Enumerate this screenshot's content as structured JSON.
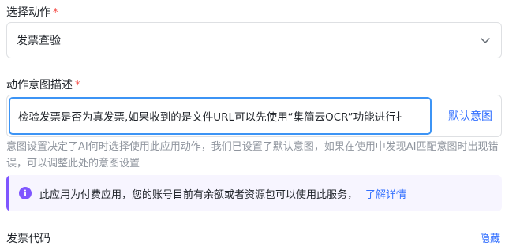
{
  "action_select": {
    "label": "选择动作",
    "required_mark": "*",
    "value": "发票查验",
    "chevron_icon": "chevron-down-icon"
  },
  "intent": {
    "label": "动作意图描述",
    "required_mark": "*",
    "value": "检验发票是否为真发票,如果收到的是文件URL可以先使用“集简云OCR”功能进行扌",
    "default_button": "默认意图",
    "hint": "意图设置决定了AI何时选择使用此应用动作，我们已设置了默认意图，如果在使用中发现AI匹配意图时出现错误，可以调整此处的意图设置"
  },
  "notice": {
    "icon": "info-icon",
    "message": "此应用为付费应用，您的账号目前有余额或者资源包可以使用此服务，",
    "link": "了解详情",
    "accent_color": "#7f56ff"
  },
  "code_section": {
    "label": "发票代码",
    "toggle": "隐藏"
  }
}
